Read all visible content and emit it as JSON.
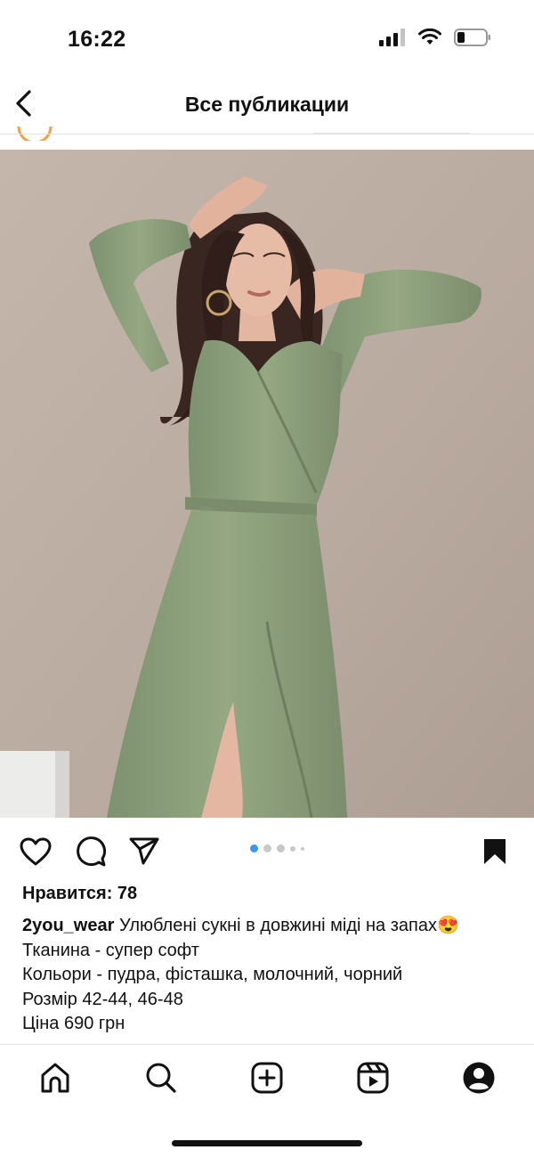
{
  "status_bar": {
    "time": "16:22",
    "icons": [
      "cellular-signal-icon",
      "wifi-icon",
      "battery-icon"
    ]
  },
  "header": {
    "title": "Все публикации",
    "back_icon": "chevron-left-icon"
  },
  "post": {
    "image_description_icon": "photo",
    "carousel": {
      "total": 5,
      "active_index": 0
    },
    "actions": [
      "heart-icon",
      "comment-icon",
      "share-icon",
      "bookmark-icon"
    ],
    "likes_text": "Нравится: 78",
    "caption": {
      "username": "2you_wear",
      "first_line": " Улюблені сукні в довжині міді на запах😍",
      "lines": [
        "Тканина - супер софт",
        "Кольори - пудра, фісташка, молочний, чорний",
        "Розмір 42-44, 46-48",
        "Ціна 690 грн"
      ]
    }
  },
  "tab_bar": {
    "items": [
      "home-icon",
      "search-icon",
      "create-icon",
      "reels-icon",
      "profile-icon"
    ]
  },
  "colors": {
    "accent_dot": "#3897f0",
    "dress": "#8fa37e",
    "background_wall": "#bcada2"
  }
}
